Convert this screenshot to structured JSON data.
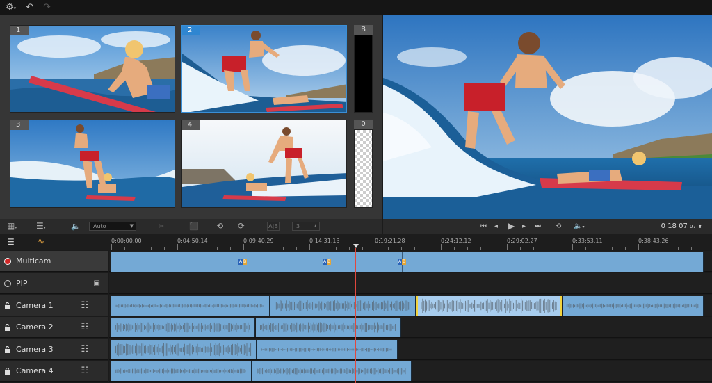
{
  "toolbar": {
    "icons": [
      "gear-icon",
      "undo-icon",
      "redo-icon"
    ]
  },
  "sources": {
    "cameras": [
      {
        "number": "1",
        "selected": false
      },
      {
        "number": "2",
        "selected": true
      },
      {
        "number": "3",
        "selected": false
      },
      {
        "number": "4",
        "selected": false
      }
    ],
    "background_label": "B",
    "overlay_label": "0"
  },
  "source_toolbar": {
    "audio_mode": "Auto",
    "count_value": "3",
    "ab_label": "A|B"
  },
  "preview": {
    "timecode": "0 18 07",
    "frames": "07"
  },
  "timeline": {
    "ruler": [
      "0:00:00.00",
      "0:04:50.14",
      "0:09:40.29",
      "0:14:31.13",
      "0:19:21.28",
      "0:24:12.12",
      "0:29:02.27",
      "0:33:53.11",
      "0:38:43.26"
    ],
    "tracks": [
      {
        "name": "Multicam",
        "kind": "multicam"
      },
      {
        "name": "PIP",
        "kind": "pip"
      },
      {
        "name": "Camera 1",
        "kind": "camera"
      },
      {
        "name": "Camera 2",
        "kind": "camera"
      },
      {
        "name": "Camera 3",
        "kind": "camera"
      },
      {
        "name": "Camera 4",
        "kind": "camera"
      }
    ],
    "marker_label_a": "A",
    "marker_label_b": "B"
  },
  "colors": {
    "clip": "#74a9d5",
    "highlight_border": "#f2d440",
    "selected_camera": "#2f86d1",
    "playhead": "#e0483e"
  }
}
